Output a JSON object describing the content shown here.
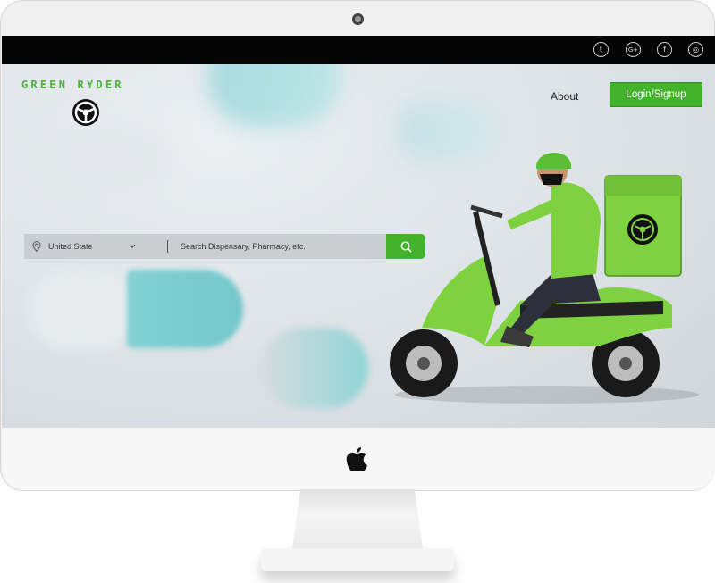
{
  "brand": {
    "name": "GREEN RYDER"
  },
  "nav": {
    "about": "About",
    "login": "Login/Signup"
  },
  "social": [
    {
      "icon": "twitter-icon",
      "glyph": "t"
    },
    {
      "icon": "google-plus-icon",
      "glyph": "G+"
    },
    {
      "icon": "facebook-icon",
      "glyph": "f"
    },
    {
      "icon": "instagram-icon",
      "glyph": "◎"
    }
  ],
  "search": {
    "location_value": "United State",
    "query_placeholder": "Search Dispensary, Pharmacy, etc."
  },
  "colors": {
    "accent": "#45b22e",
    "topbar": "#050505"
  }
}
